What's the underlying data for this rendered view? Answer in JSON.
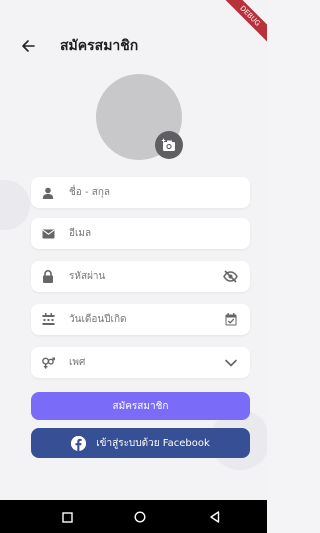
{
  "status_bar": {
    "debug_label": "DEBUG"
  },
  "header": {
    "title": "สมัครสมาชิก",
    "back_icon": "arrow-left-icon"
  },
  "avatar": {
    "camera_icon": "add-photo-icon"
  },
  "form": {
    "name_placeholder": "ชื่อ - สกุล",
    "email_placeholder": "อีเมล",
    "password_placeholder": "รหัสผ่าน",
    "birthdate_placeholder": "วันเดือนปีเกิด",
    "gender_placeholder": "เพศ"
  },
  "actions": {
    "register_label": "สมัครสมาชิก",
    "facebook_label": "เข้าสู่ระบบด้วย Facebook"
  },
  "colors": {
    "primary": "#7a6cf8",
    "facebook": "#374f94",
    "avatar_bg": "#c8c8ca",
    "field_bg": "#ffffff",
    "page_bg": "#f3f3f5"
  }
}
